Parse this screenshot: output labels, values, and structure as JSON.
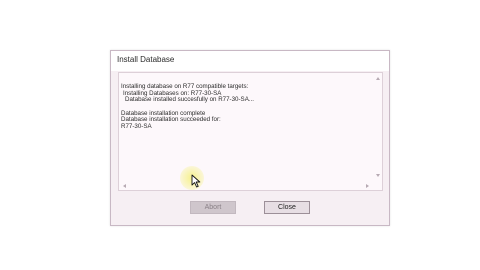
{
  "dialog": {
    "title": "Install Database",
    "log_lines": [
      "Installing database on R77 compatible targets:",
      "Installing Databases on: R77-30-SA",
      "Database installed succesfully on R77-30-SA...",
      "",
      "Database installation complete",
      "Database installation succeeded for:",
      "R77-30-SA"
    ],
    "buttons": {
      "abort_label": "Abort",
      "close_label": "Close"
    }
  },
  "colors": {
    "dialog_bg": "#f6eff3",
    "titlebar_bg": "#ffffff",
    "textarea_bg": "#fdf8fb",
    "cursor_highlight": "#f5f078"
  },
  "icons": {
    "scroll_up": "chevron-up-icon",
    "scroll_down": "chevron-down-icon",
    "scroll_left": "chevron-left-icon",
    "scroll_right": "chevron-right-icon",
    "pointer": "mouse-pointer-icon"
  }
}
